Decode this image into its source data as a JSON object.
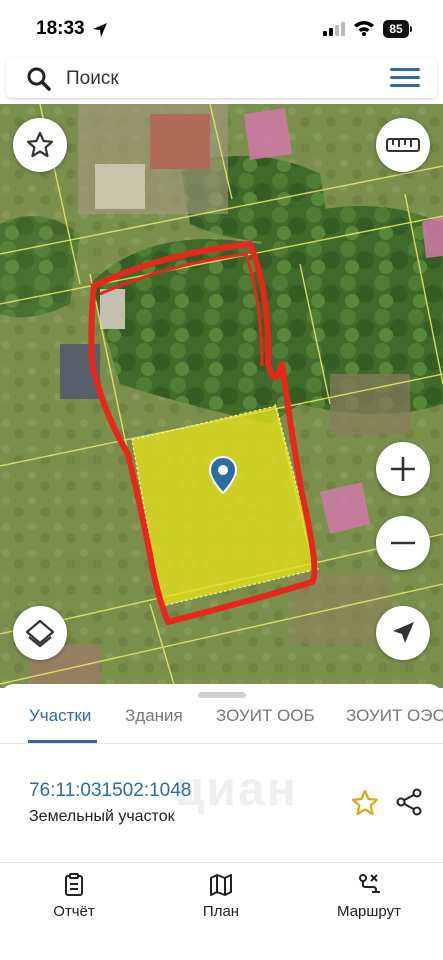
{
  "status": {
    "time": "18:33",
    "battery": "85"
  },
  "search": {
    "placeholder": "Поиск"
  },
  "tabs": [
    {
      "label": "Участки",
      "active": true
    },
    {
      "label": "Здания",
      "active": false
    },
    {
      "label": "ЗОУИТ ООБ",
      "active": false
    },
    {
      "label": "ЗОУИТ ОЭС",
      "active": false
    }
  ],
  "parcel": {
    "cadastral_number": "76:11:031502:1048",
    "type": "Земельный участок"
  },
  "watermark": "циан",
  "nav": [
    {
      "label": "Отчёт",
      "icon": "report-icon"
    },
    {
      "label": "План",
      "icon": "map-plan-icon"
    },
    {
      "label": "Маршрут",
      "icon": "route-icon"
    }
  ],
  "colors": {
    "accent": "#2b6ca3",
    "parcel_fill": "#e4e21a",
    "outline": "#e8261c",
    "pin": "#2b6ca3"
  }
}
